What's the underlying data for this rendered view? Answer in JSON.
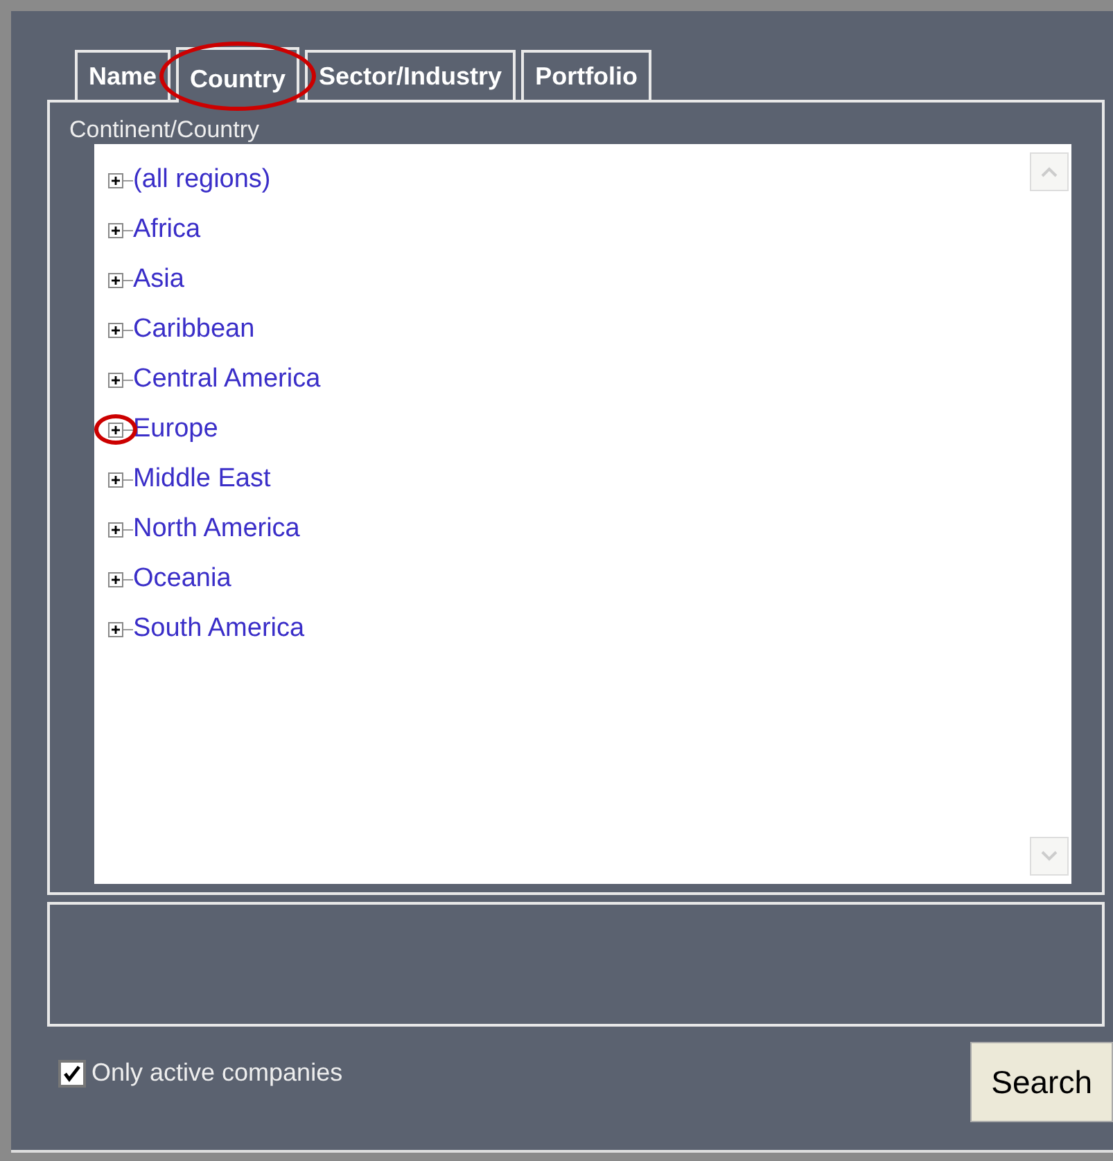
{
  "tabs": [
    {
      "label": "Name",
      "selected": false,
      "circled": false
    },
    {
      "label": "Country",
      "selected": true,
      "circled": true
    },
    {
      "label": "Sector/Industry",
      "selected": false,
      "circled": false
    },
    {
      "label": "Portfolio",
      "selected": false,
      "circled": false
    }
  ],
  "tree": {
    "label": "Continent/Country",
    "items": [
      {
        "label": "(all regions)",
        "expanded": false,
        "circled": false
      },
      {
        "label": "Africa",
        "expanded": false,
        "circled": false
      },
      {
        "label": "Asia",
        "expanded": false,
        "circled": false
      },
      {
        "label": "Caribbean",
        "expanded": false,
        "circled": false
      },
      {
        "label": "Central America",
        "expanded": false,
        "circled": false
      },
      {
        "label": "Europe",
        "expanded": false,
        "circled": true
      },
      {
        "label": "Middle East",
        "expanded": false,
        "circled": false
      },
      {
        "label": "North America",
        "expanded": false,
        "circled": false
      },
      {
        "label": "Oceania",
        "expanded": false,
        "circled": false
      },
      {
        "label": "South America",
        "expanded": false,
        "circled": false
      }
    ]
  },
  "only_active": {
    "label": "Only active companies",
    "checked": true
  },
  "search_button": "Search"
}
